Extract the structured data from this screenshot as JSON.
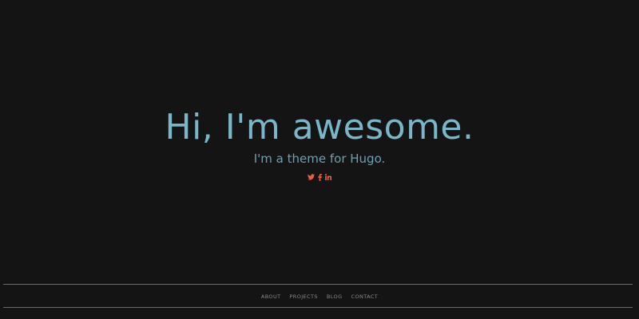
{
  "hero": {
    "title": "Hi, I'm awesome.",
    "subtitle": "I'm a theme for Hugo."
  },
  "social": {
    "icon_color": "#e8604c",
    "links": [
      {
        "icon": "twitter-icon"
      },
      {
        "icon": "facebook-icon"
      },
      {
        "icon": "linkedin-icon"
      }
    ]
  },
  "footer": {
    "nav": [
      {
        "label": "ABOUT"
      },
      {
        "label": "PROJECTS"
      },
      {
        "label": "BLOG"
      },
      {
        "label": "CONTACT"
      }
    ]
  },
  "colors": {
    "background": "#141414",
    "title": "#79b6c8",
    "subtitle": "#6f9fb0",
    "nav_text": "#8a8a8a",
    "rule": "#6a6a6a"
  }
}
